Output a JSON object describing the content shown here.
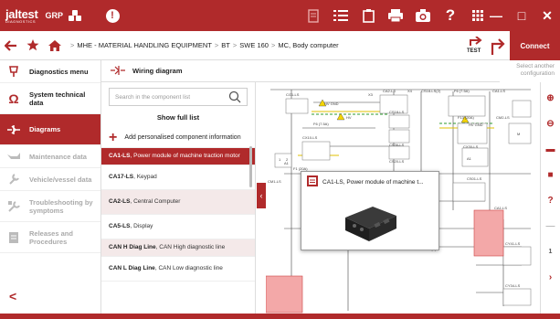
{
  "brand": {
    "logo": "jaltest",
    "logo_sub": "DIAGNOSTICS",
    "group": "GRP"
  },
  "breadcrumb": {
    "items": [
      "MHE - MATERIAL HANDLING EQUIPMENT",
      "BT",
      "SWE 160",
      "MC, Body computer"
    ],
    "separator": ">"
  },
  "connect_label": "Connect",
  "test_label": "TEST",
  "window_buttons": {
    "minimize": "—",
    "maximize": "□",
    "close": "✕"
  },
  "sidebar": {
    "items": [
      {
        "label": "Diagnostics menu",
        "icon": "diagnostics-menu-icon",
        "state": "normal"
      },
      {
        "label": "System technical data",
        "icon": "ohm-icon",
        "state": "normal"
      },
      {
        "label": "Diagrams",
        "icon": "diagram-icon",
        "state": "active"
      },
      {
        "label": "Maintenance data",
        "icon": "oil-can-icon",
        "state": "dim"
      },
      {
        "label": "Vehicle/vessel data",
        "icon": "wrench-icon",
        "state": "dim"
      },
      {
        "label": "Troubleshooting by symptoms",
        "icon": "symptoms-icon",
        "state": "dim"
      },
      {
        "label": "Releases and Procedures",
        "icon": "document-icon",
        "state": "dim"
      }
    ],
    "back": "<"
  },
  "section": {
    "title": "Wiring diagram",
    "select_another": "Select another configuration"
  },
  "component_list": {
    "search_placeholder": "Search in the component list",
    "full_list": "Show full list",
    "add_personalised": "Add personalised component information",
    "items": [
      {
        "code": "CA1-LS",
        "desc": "Power module of machine traction motor"
      },
      {
        "code": "CA17-LS",
        "desc": "Keypad"
      },
      {
        "code": "CA2-LS",
        "desc": "Central Computer"
      },
      {
        "code": "CA5-LS",
        "desc": "Display"
      },
      {
        "code": "CAN H Diag Line",
        "desc": "CAN High diagnostic line"
      },
      {
        "code": "CAN L Diag Line",
        "desc": "CAN Low diagnostic line"
      }
    ]
  },
  "popup": {
    "title": "CA1-LS, Power module of machine t..."
  },
  "diagram_labels": {
    "l1": "CG1-LS",
    "l2": "X3",
    "l3": "CA2-LS",
    "l4": "X4",
    "l5": "CS18-LS(2)",
    "l6": "F6 (7.5A)",
    "l7": "CA1-LS",
    "l8": "HV GND",
    "l9": "HV",
    "l10": "F6 (7.5A)",
    "l11": "CX10-LS",
    "l12": "CS18-LS",
    "l13": "F13 (20A)",
    "l14": "HV GND",
    "l15": "CM2-LS",
    "l16": "M",
    "l17": "CX30-LS",
    "l18": "A1",
    "l19": "CS36-LS",
    "l20": "CS20-LS",
    "l21": "F1 (20A)",
    "l22": "CS01-LS",
    "l23": "CA1-LS",
    "l24": "HV GND",
    "l25": "CS42-LS(2)",
    "l26": "CY41-LS",
    "l27": "CY34-LS",
    "l28": "CM1-LS",
    "l29": "A1",
    "l30": "1",
    "l31": "2"
  },
  "rail_icons": [
    "zoom-in-icon",
    "zoom-out-icon",
    "print-icon",
    "lock-icon",
    "help-icon",
    "minus-icon",
    "page-icon",
    "next-icon"
  ],
  "colors": {
    "accent": "#b02a2b",
    "active_row": "#f4e9e9"
  }
}
